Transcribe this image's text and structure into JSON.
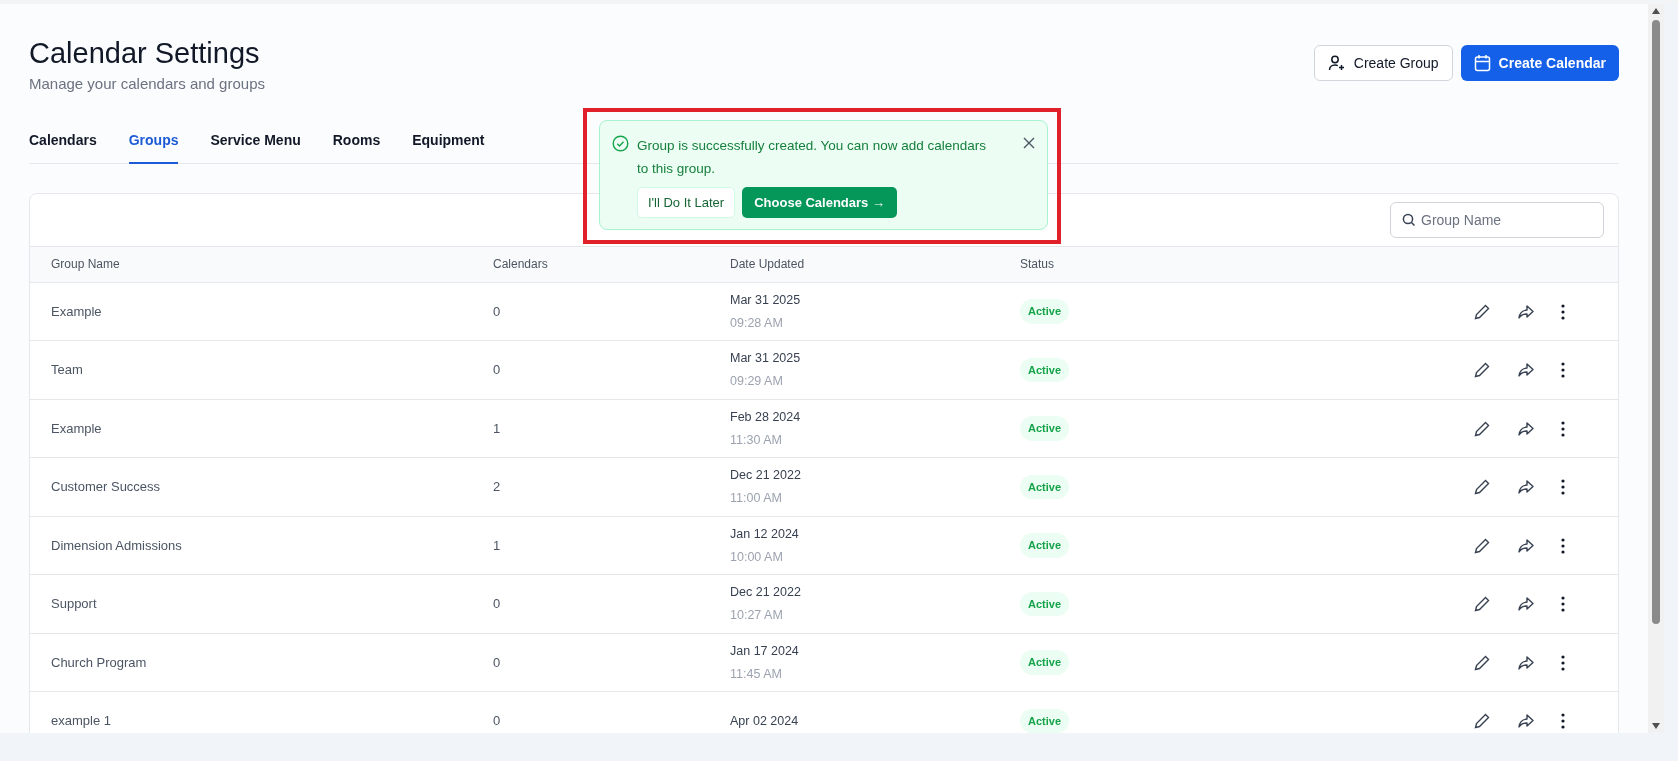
{
  "header": {
    "title": "Calendar Settings",
    "subtitle": "Manage your calendars and groups"
  },
  "actions": [
    {
      "kind": "outline",
      "label": "Create Group"
    },
    {
      "kind": "primary",
      "label": "Create Calendar"
    }
  ],
  "tabs": [
    {
      "label": "Calendars",
      "selected": false
    },
    {
      "label": "Groups",
      "selected": true
    },
    {
      "label": "Service Menu",
      "selected": false
    },
    {
      "label": "Rooms",
      "selected": false
    },
    {
      "label": "Equipment",
      "selected": false
    }
  ],
  "toast": {
    "message": "Group is successfully created. You can now add calendars to this group.",
    "buttons": [
      {
        "kind": "secondary",
        "label": "I'll Do It Later"
      },
      {
        "kind": "primary",
        "label": "Choose Calendars →"
      }
    ]
  },
  "search": {
    "placeholder": "Group Name"
  },
  "table": {
    "columns": [
      "Group Name",
      "Calendars",
      "Date Updated",
      "Status"
    ],
    "rows": [
      {
        "name": "Example",
        "calendars": "0",
        "date": "Mar 31 2025",
        "time": "09:28 AM",
        "status": "Active"
      },
      {
        "name": "Team",
        "calendars": "0",
        "date": "Mar 31 2025",
        "time": "09:29 AM",
        "status": "Active"
      },
      {
        "name": "Example",
        "calendars": "1",
        "date": "Feb 28 2024",
        "time": "11:30 AM",
        "status": "Active"
      },
      {
        "name": "Customer Success",
        "calendars": "2",
        "date": "Dec 21 2022",
        "time": "11:00 AM",
        "status": "Active"
      },
      {
        "name": "Dimension Admissions",
        "calendars": "1",
        "date": "Jan 12 2024",
        "time": "10:00 AM",
        "status": "Active"
      },
      {
        "name": "Support",
        "calendars": "0",
        "date": "Dec 21 2022",
        "time": "10:27 AM",
        "status": "Active"
      },
      {
        "name": "Church Program",
        "calendars": "0",
        "date": "Jan 17 2024",
        "time": "11:45 AM",
        "status": "Active"
      },
      {
        "name": "example 1",
        "calendars": "0",
        "date": "Apr 02 2024",
        "status": "Active"
      }
    ]
  }
}
